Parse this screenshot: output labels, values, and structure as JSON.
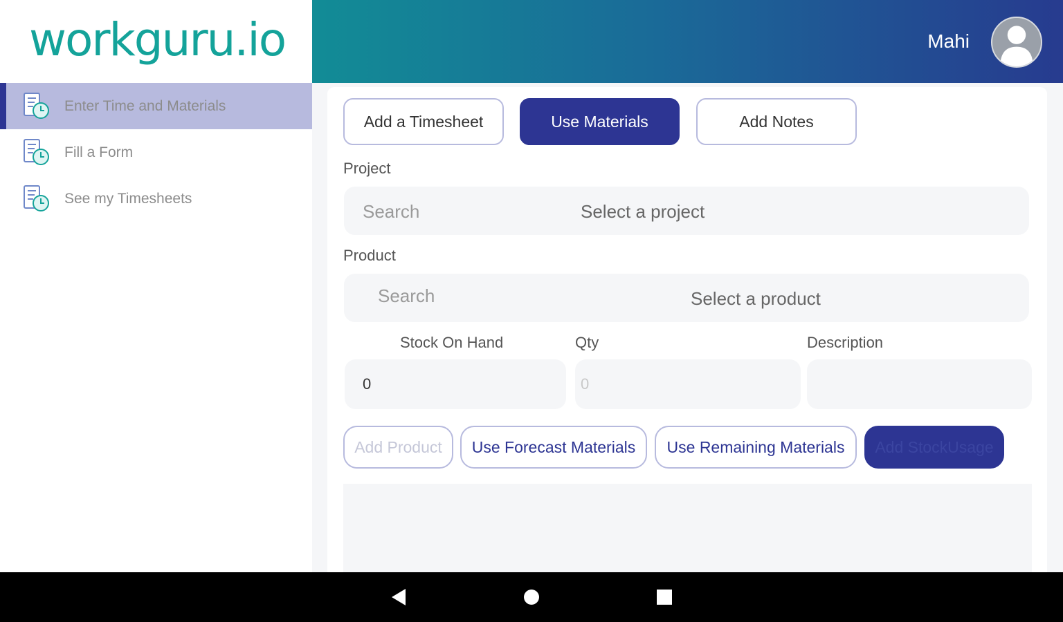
{
  "app": {
    "logo_text": "workguru.io"
  },
  "header": {
    "user_name": "Mahi"
  },
  "sidebar": {
    "items": [
      {
        "label": "Enter Time and Materials",
        "icon": "timesheet-icon",
        "active": true
      },
      {
        "label": "Fill a Form",
        "icon": "timesheet-icon",
        "active": false
      },
      {
        "label": "See my Timesheets",
        "icon": "timesheet-icon",
        "active": false
      }
    ]
  },
  "tabs": [
    {
      "label": "Add a Timesheet",
      "active": false
    },
    {
      "label": "Use Materials",
      "active": true
    },
    {
      "label": "Add Notes",
      "active": false
    }
  ],
  "form": {
    "project": {
      "label": "Project",
      "search_placeholder": "Search",
      "select_placeholder": "Select a project"
    },
    "product": {
      "label": "Product",
      "search_placeholder": "Search",
      "select_placeholder": "Select a product"
    },
    "stock_on_hand": {
      "label": "Stock On Hand",
      "value": "0"
    },
    "qty": {
      "label": "Qty",
      "placeholder": "0"
    },
    "description": {
      "label": "Description",
      "value": ""
    }
  },
  "actions": {
    "add_product": "Add Product",
    "use_forecast": "Use Forecast Materials",
    "use_remaining": "Use Remaining Materials",
    "add_stock_usage": "Add StockUsage"
  },
  "colors": {
    "brand_teal": "#14a39a",
    "primary_navy": "#2d3593",
    "active_nav_bg": "#b7bade",
    "field_bg": "#f5f6f8"
  },
  "system_nav": {
    "back_icon": "back-triangle-icon",
    "home_icon": "home-circle-icon",
    "recents_icon": "recents-square-icon"
  }
}
